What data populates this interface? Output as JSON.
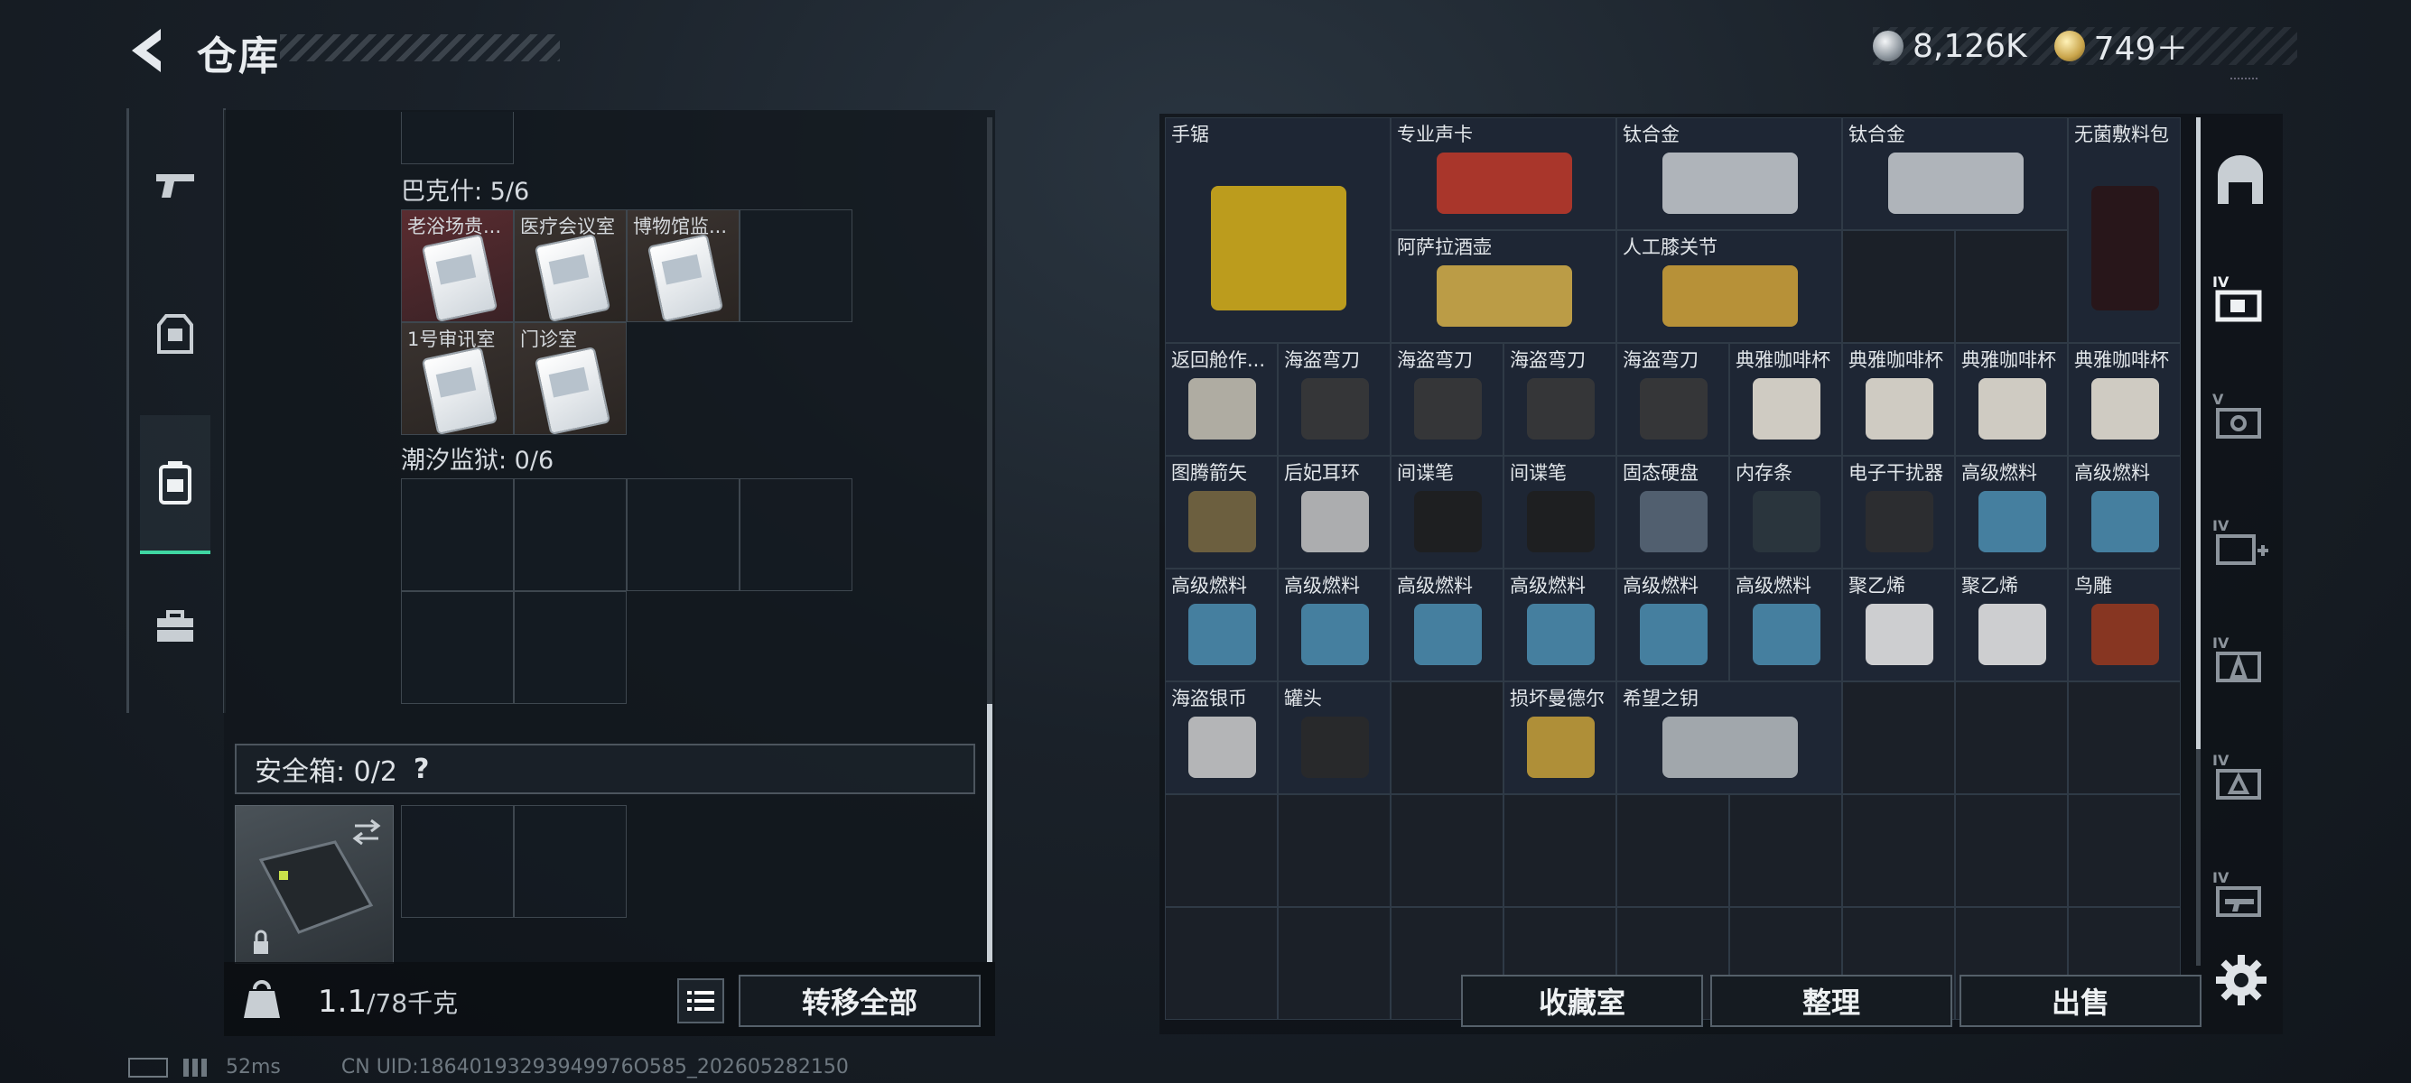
{
  "header": {
    "title": "仓库"
  },
  "currency": {
    "silver": "8,126K",
    "gold": "749＋"
  },
  "inventory": {
    "group1": {
      "label": "巴克什: 5/6",
      "items": [
        "老浴场贵...",
        "医疗会议室",
        "博物馆监...",
        "1号审讯室",
        "门诊室"
      ]
    },
    "group2": {
      "label": "潮汐监狱: 0/6"
    },
    "safe": {
      "label": "安全箱:  0/2",
      "help": "?"
    },
    "weight": {
      "current": "1.1",
      "max": "/78千克"
    },
    "transfer_all": "转移全部"
  },
  "storage": {
    "rows": [
      [
        "手锯",
        "",
        "专业声卡",
        "",
        "钛合金",
        "",
        "钛合金",
        "",
        "无菌敷料包"
      ],
      [
        "",
        "",
        "阿萨拉酒壶",
        "",
        "人工膝关节",
        "",
        "",
        "",
        ""
      ],
      [
        "返回舱作...",
        "海盗弯刀",
        "海盗弯刀",
        "海盗弯刀",
        "海盗弯刀",
        "典雅咖啡杯",
        "典雅咖啡杯",
        "典雅咖啡杯",
        "典雅咖啡杯"
      ],
      [
        "图腾箭矢",
        "后妃耳环",
        "间谍笔",
        "间谍笔",
        "固态硬盘",
        "内存条",
        "电子干扰器",
        "高级燃料",
        "高级燃料"
      ],
      [
        "高级燃料",
        "高级燃料",
        "高级燃料",
        "高级燃料",
        "高级燃料",
        "高级燃料",
        "聚乙烯",
        "聚乙烯",
        "鸟雕"
      ],
      [
        "海盗银币",
        "罐头",
        "",
        "损坏曼德尔",
        "希望之钥",
        "",
        "",
        "",
        ""
      ]
    ]
  },
  "buttons": {
    "collection": "收藏室",
    "sort": "整理",
    "sell": "出售"
  },
  "status": {
    "ping": "52ms",
    "uid": "CN UID:18640193293949976O585_202605282150"
  },
  "colors": {
    "accent": "#3fd6a2",
    "item_bg": "#1e2634"
  }
}
